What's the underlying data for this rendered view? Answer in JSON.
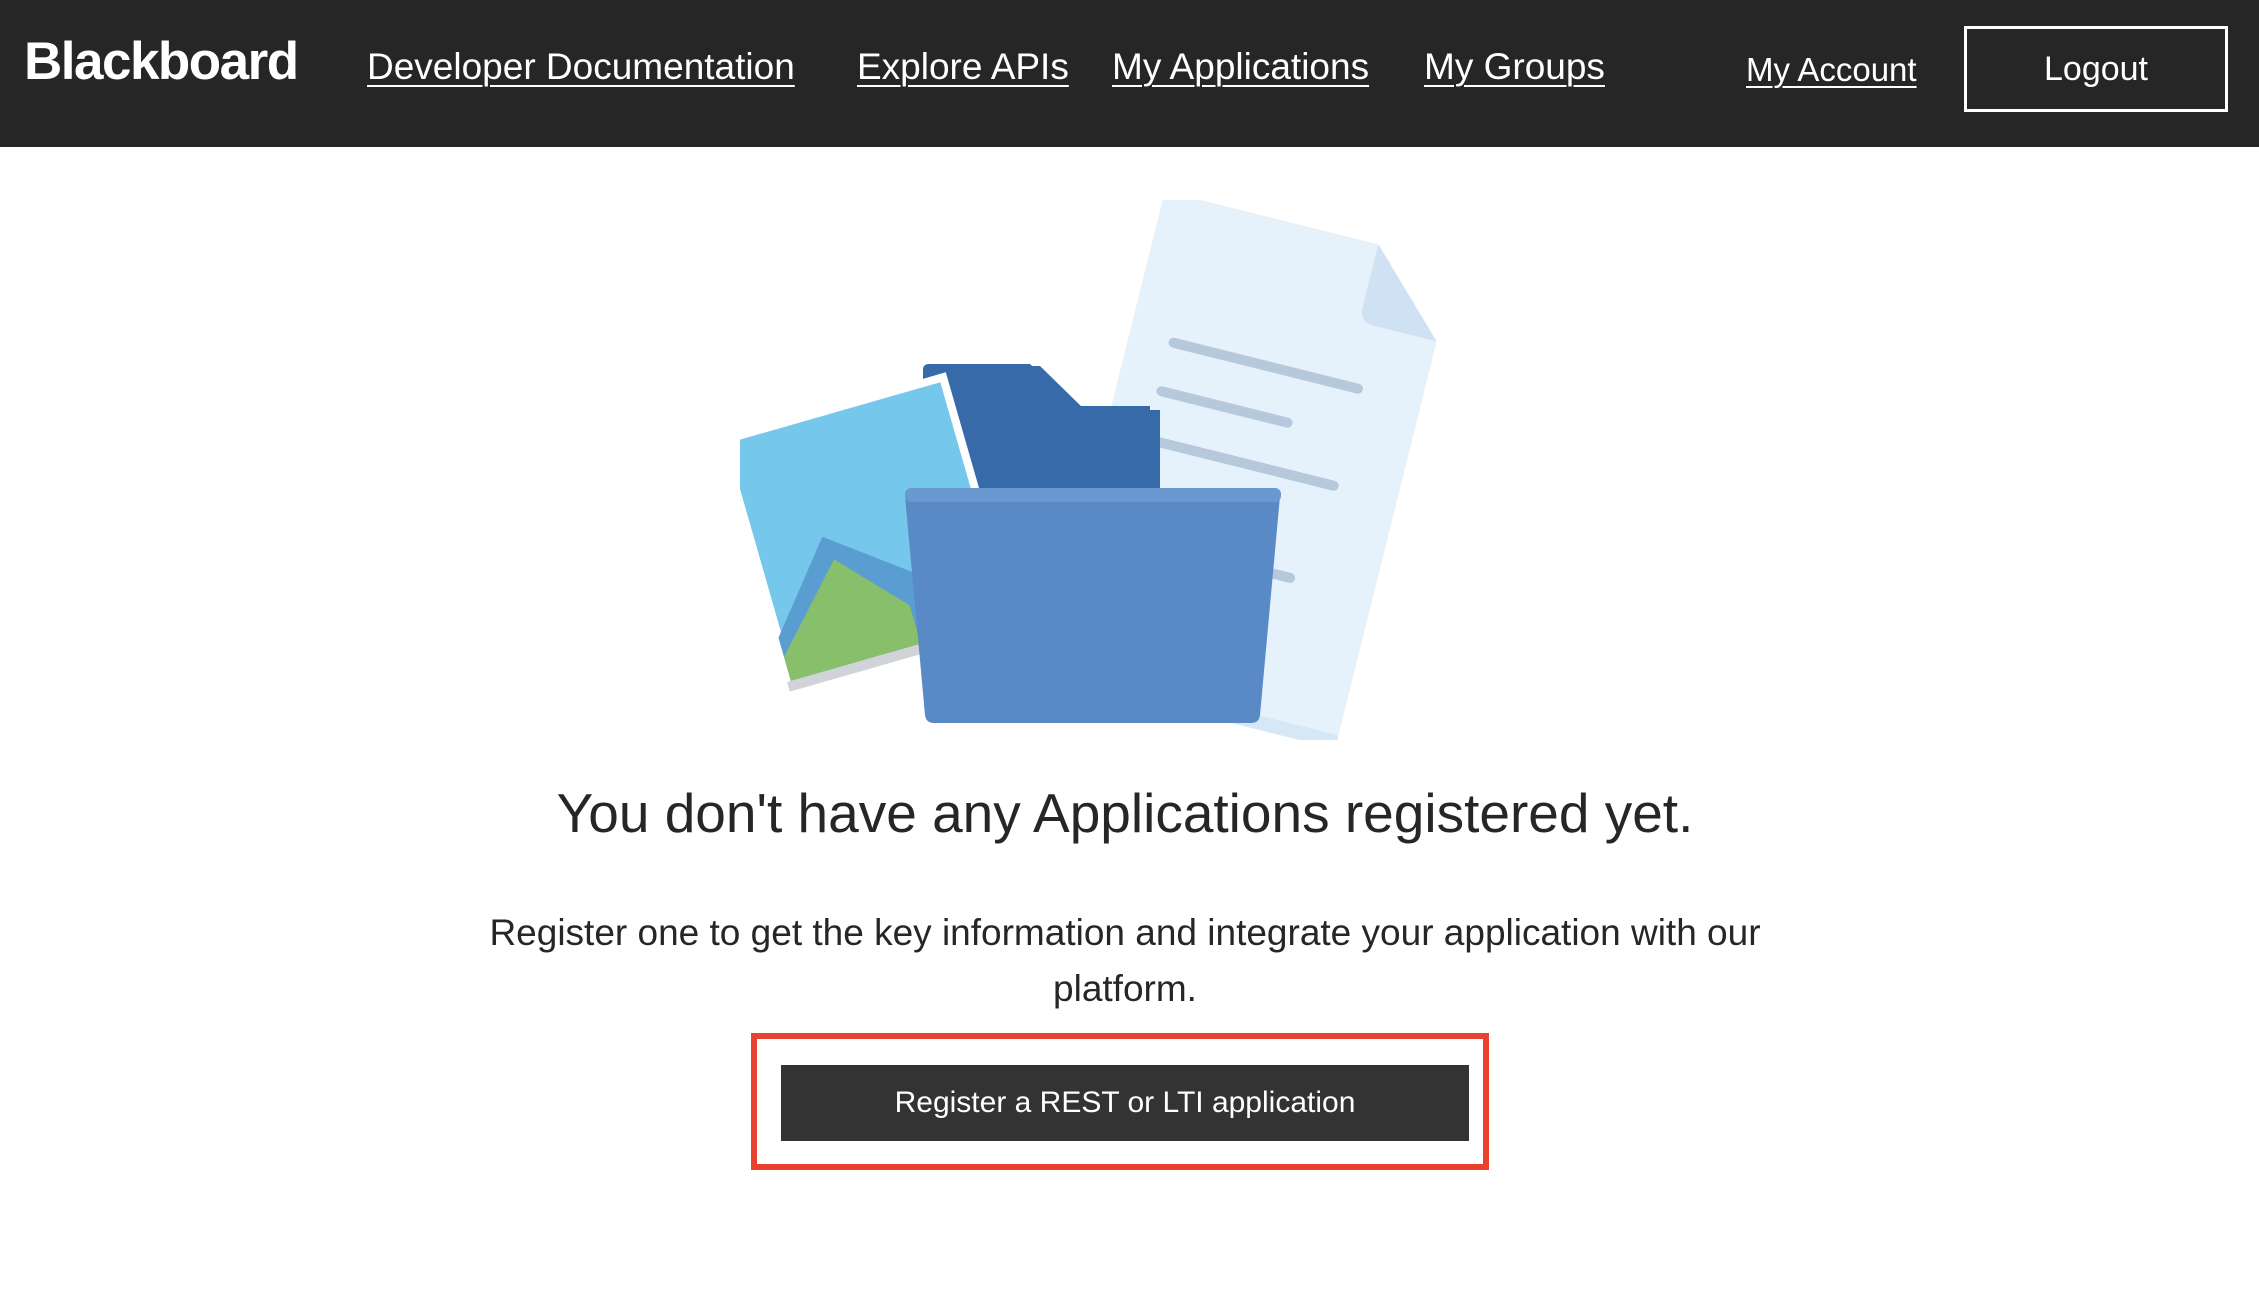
{
  "header": {
    "logo_text": "Blackboard",
    "nav": [
      {
        "label": "Developer Documentation"
      },
      {
        "label": "Explore APIs"
      },
      {
        "label": "My Applications"
      },
      {
        "label": "My Groups"
      }
    ],
    "account_label": "My Account",
    "logout_label": "Logout"
  },
  "empty_state": {
    "illustration_icon": "folder-with-files-illustration",
    "title": "You don't have any Applications registered yet.",
    "description": "Register one to get the key information and integrate your application with our platform.",
    "register_button_label": "Register a REST or LTI application"
  },
  "colors": {
    "header_bg": "#262626",
    "button_bg": "#333333",
    "highlight": "#e8412e",
    "folder_front": "#5a8ac6",
    "folder_back": "#366aa9",
    "document": "#e5f1fb",
    "photo": "#76c7ec"
  }
}
